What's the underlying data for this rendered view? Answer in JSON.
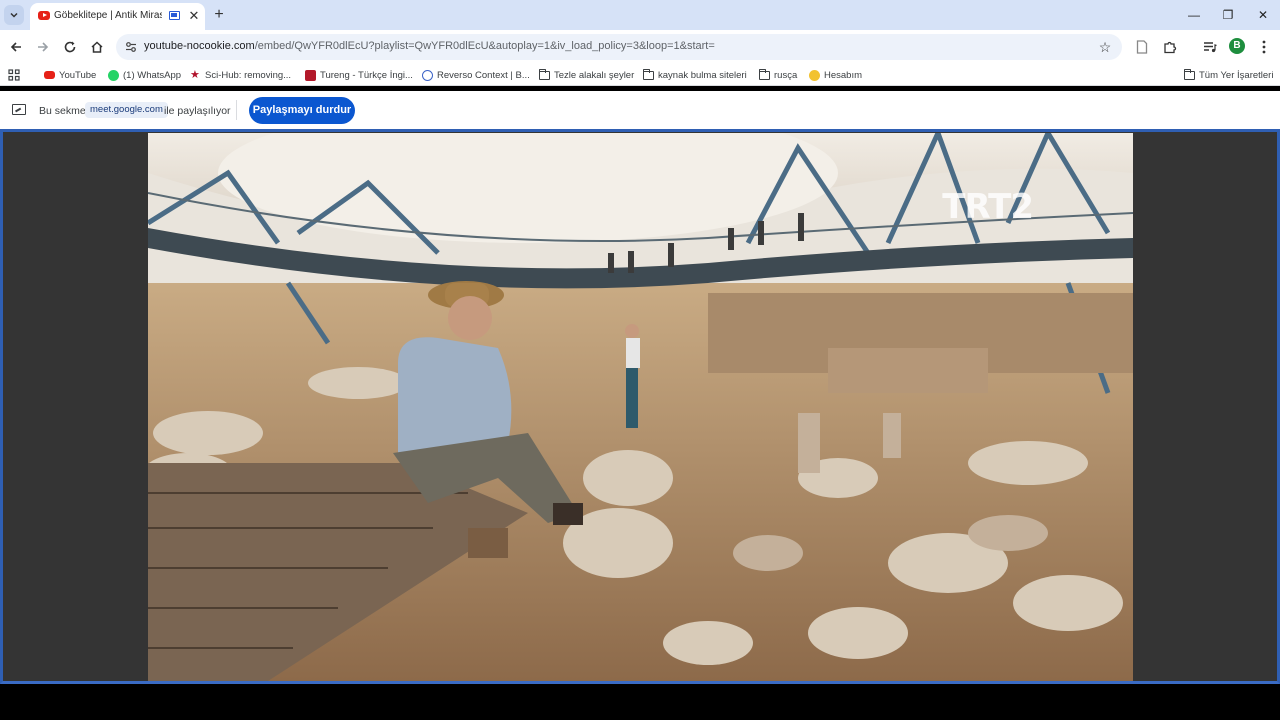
{
  "browser": {
    "tab": {
      "title": "Göbeklitepe | Antik Miras |",
      "favicon": "youtube-icon"
    },
    "new_tab_label": "+",
    "window_controls": {
      "minimize": "—",
      "restore": "❐",
      "close": "✕"
    },
    "url": {
      "host": "youtube-nocookie.com",
      "path": "/embed/QwYFR0dlEcU?playlist=QwYFR0dlEcU&autoplay=1&iv_load_policy=3&loop=1&start="
    },
    "profile_initial": "B"
  },
  "bookmarks": {
    "items": [
      {
        "label": "YouTube",
        "icon": "youtube-icon"
      },
      {
        "label": "(1) WhatsApp",
        "icon": "whatsapp-icon"
      },
      {
        "label": "Sci-Hub: removing...",
        "icon": "scihub-icon"
      },
      {
        "label": "Tureng - Türkçe İngi...",
        "icon": "tureng-icon"
      },
      {
        "label": "Reverso Context | B...",
        "icon": "reverso-icon"
      },
      {
        "label": "Tezle alakalı şeyler",
        "icon": "folder-icon"
      },
      {
        "label": "kaynak bulma siteleri",
        "icon": "folder-icon"
      },
      {
        "label": "rusça",
        "icon": "folder-icon"
      },
      {
        "label": "Hesabım",
        "icon": "account-icon"
      }
    ],
    "all_bookmarks": "Tüm Yer İşaretleri"
  },
  "sharebar": {
    "prefix": "Bu sekme",
    "domain": "meet.google.com",
    "suffix": "ile paylaşılıyor",
    "stop_button": "Paylaşmayı durdur"
  },
  "video": {
    "channel_logo": "TRT2"
  },
  "colors": {
    "tabstrip": "#d6e2f7",
    "accent": "#0b57d0",
    "share_border": "#2f5fb3"
  }
}
